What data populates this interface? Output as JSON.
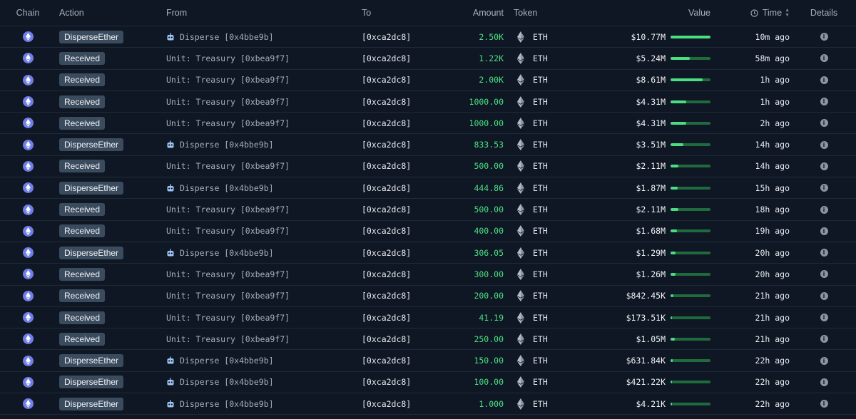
{
  "header": {
    "chain": "Chain",
    "action": "Action",
    "from": "From",
    "to": "To",
    "amount": "Amount",
    "token": "Token",
    "value": "Value",
    "time": "Time",
    "details": "Details"
  },
  "colors": {
    "background": "#0f1724",
    "amount_green": "#4ade80",
    "badge_bg": "#3b4b5e",
    "chain_icon": "#6f7fe6",
    "bar_track": "#1f6b3e",
    "bar_fill": "#4ade80"
  },
  "icons": {
    "chain": "ethereum-icon",
    "token": "ethereum-diamond-icon",
    "from_disperse": "robot-icon",
    "details": "info-icon",
    "time": "clock-icon",
    "sort": "sort-icon"
  },
  "rows": [
    {
      "action": "DisperseEther",
      "from": "Disperse [0x4bbe9b]",
      "from_icon": true,
      "to": "[0xca2dc8]",
      "amount": "2.50K",
      "token": "ETH",
      "value": "$10.77M",
      "value_fraction": 1.0,
      "time": "10m ago"
    },
    {
      "action": "Received",
      "from": "Unit: Treasury [0xbea9f7]",
      "from_icon": false,
      "to": "[0xca2dc8]",
      "amount": "1.22K",
      "token": "ETH",
      "value": "$5.24M",
      "value_fraction": 0.49,
      "time": "58m ago"
    },
    {
      "action": "Received",
      "from": "Unit: Treasury [0xbea9f7]",
      "from_icon": false,
      "to": "[0xca2dc8]",
      "amount": "2.00K",
      "token": "ETH",
      "value": "$8.61M",
      "value_fraction": 0.8,
      "time": "1h ago"
    },
    {
      "action": "Received",
      "from": "Unit: Treasury [0xbea9f7]",
      "from_icon": false,
      "to": "[0xca2dc8]",
      "amount": "1000.00",
      "token": "ETH",
      "value": "$4.31M",
      "value_fraction": 0.4,
      "time": "1h ago"
    },
    {
      "action": "Received",
      "from": "Unit: Treasury [0xbea9f7]",
      "from_icon": false,
      "to": "[0xca2dc8]",
      "amount": "1000.00",
      "token": "ETH",
      "value": "$4.31M",
      "value_fraction": 0.4,
      "time": "2h ago"
    },
    {
      "action": "DisperseEther",
      "from": "Disperse [0x4bbe9b]",
      "from_icon": true,
      "to": "[0xca2dc8]",
      "amount": "833.53",
      "token": "ETH",
      "value": "$3.51M",
      "value_fraction": 0.33,
      "time": "14h ago"
    },
    {
      "action": "Received",
      "from": "Unit: Treasury [0xbea9f7]",
      "from_icon": false,
      "to": "[0xca2dc8]",
      "amount": "500.00",
      "token": "ETH",
      "value": "$2.11M",
      "value_fraction": 0.2,
      "time": "14h ago"
    },
    {
      "action": "DisperseEther",
      "from": "Disperse [0x4bbe9b]",
      "from_icon": true,
      "to": "[0xca2dc8]",
      "amount": "444.86",
      "token": "ETH",
      "value": "$1.87M",
      "value_fraction": 0.17,
      "time": "15h ago"
    },
    {
      "action": "Received",
      "from": "Unit: Treasury [0xbea9f7]",
      "from_icon": false,
      "to": "[0xca2dc8]",
      "amount": "500.00",
      "token": "ETH",
      "value": "$2.11M",
      "value_fraction": 0.2,
      "time": "18h ago"
    },
    {
      "action": "Received",
      "from": "Unit: Treasury [0xbea9f7]",
      "from_icon": false,
      "to": "[0xca2dc8]",
      "amount": "400.00",
      "token": "ETH",
      "value": "$1.68M",
      "value_fraction": 0.16,
      "time": "19h ago"
    },
    {
      "action": "DisperseEther",
      "from": "Disperse [0x4bbe9b]",
      "from_icon": true,
      "to": "[0xca2dc8]",
      "amount": "306.05",
      "token": "ETH",
      "value": "$1.29M",
      "value_fraction": 0.12,
      "time": "20h ago"
    },
    {
      "action": "Received",
      "from": "Unit: Treasury [0xbea9f7]",
      "from_icon": false,
      "to": "[0xca2dc8]",
      "amount": "300.00",
      "token": "ETH",
      "value": "$1.26M",
      "value_fraction": 0.12,
      "time": "20h ago"
    },
    {
      "action": "Received",
      "from": "Unit: Treasury [0xbea9f7]",
      "from_icon": false,
      "to": "[0xca2dc8]",
      "amount": "200.00",
      "token": "ETH",
      "value": "$842.45K",
      "value_fraction": 0.08,
      "time": "21h ago"
    },
    {
      "action": "Received",
      "from": "Unit: Treasury [0xbea9f7]",
      "from_icon": false,
      "to": "[0xca2dc8]",
      "amount": "41.19",
      "token": "ETH",
      "value": "$173.51K",
      "value_fraction": 0.016,
      "time": "21h ago"
    },
    {
      "action": "Received",
      "from": "Unit: Treasury [0xbea9f7]",
      "from_icon": false,
      "to": "[0xca2dc8]",
      "amount": "250.00",
      "token": "ETH",
      "value": "$1.05M",
      "value_fraction": 0.1,
      "time": "21h ago"
    },
    {
      "action": "DisperseEther",
      "from": "Disperse [0x4bbe9b]",
      "from_icon": true,
      "to": "[0xca2dc8]",
      "amount": "150.00",
      "token": "ETH",
      "value": "$631.84K",
      "value_fraction": 0.06,
      "time": "22h ago"
    },
    {
      "action": "DisperseEther",
      "from": "Disperse [0x4bbe9b]",
      "from_icon": true,
      "to": "[0xca2dc8]",
      "amount": "100.00",
      "token": "ETH",
      "value": "$421.22K",
      "value_fraction": 0.04,
      "time": "22h ago"
    },
    {
      "action": "DisperseEther",
      "from": "Disperse [0x4bbe9b]",
      "from_icon": true,
      "to": "[0xca2dc8]",
      "amount": "1.000",
      "token": "ETH",
      "value": "$4.21K",
      "value_fraction": 0.004,
      "time": "22h ago"
    }
  ]
}
